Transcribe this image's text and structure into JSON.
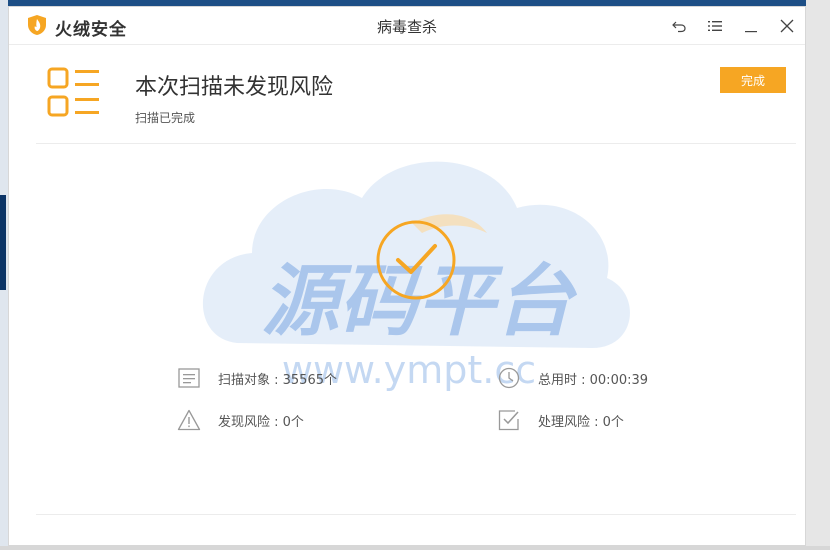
{
  "app": {
    "brand": "火绒安全",
    "title": "病毒查杀"
  },
  "colors": {
    "accent": "#f6a623",
    "watermark": "#3f7fd6"
  },
  "icons": {
    "logo": "shield-flame-icon",
    "back": "undo-icon",
    "menu": "menu-icon",
    "minimize": "minimize-icon",
    "close": "close-icon",
    "result": "checklist-icon",
    "success": "check-circle-icon"
  },
  "header": {
    "title": "本次扫描未发现风险",
    "subtitle": "扫描已完成",
    "done_label": "完成"
  },
  "watermark": {
    "cn": "源码平台",
    "url": "www.ympt.cc"
  },
  "stats": {
    "scanned": "扫描对象 : 35565个",
    "total_time": "总用时 : 00:00:39",
    "risks_found": "发现风险 : 0个",
    "risks_handled": "处理风险 : 0个"
  }
}
